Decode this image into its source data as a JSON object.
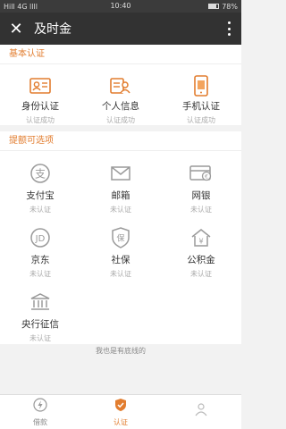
{
  "status_bar": {
    "carrier": "Hill 4G llll",
    "time": "10:40",
    "battery": "78%",
    "battery_level": 0.78
  },
  "header": {
    "title": "及时金"
  },
  "basic_section": {
    "title": "基本认证",
    "items": [
      {
        "label": "身份认证",
        "status": "认证成功",
        "icon": "id-card-icon"
      },
      {
        "label": "个人信息",
        "status": "认证成功",
        "icon": "personal-info-icon"
      },
      {
        "label": "手机认证",
        "status": "认证成功",
        "icon": "phone-icon"
      }
    ]
  },
  "optional_section": {
    "title": "提额可选项",
    "items": [
      {
        "label": "支付宝",
        "status": "未认证",
        "icon": "alipay-icon"
      },
      {
        "label": "邮箱",
        "status": "未认证",
        "icon": "mail-icon"
      },
      {
        "label": "网银",
        "status": "未认证",
        "icon": "bank-card-icon"
      },
      {
        "label": "京东",
        "status": "未认证",
        "icon": "jd-icon"
      },
      {
        "label": "社保",
        "status": "未认证",
        "icon": "social-security-icon"
      },
      {
        "label": "公积金",
        "status": "未认证",
        "icon": "housing-fund-icon"
      },
      {
        "label": "央行征信",
        "status": "未认证",
        "icon": "credit-bank-icon"
      }
    ]
  },
  "footer_note": "我也是有底线的",
  "tabs": [
    {
      "label": "借款",
      "active": false,
      "icon": "loan-icon"
    },
    {
      "label": "认证",
      "active": true,
      "icon": "verify-icon"
    },
    {
      "label": "",
      "active": false,
      "icon": "me-icon"
    }
  ],
  "colors": {
    "accent": "#e27d2f",
    "header_bg": "#323232",
    "muted_icon": "#9a9a9a"
  }
}
